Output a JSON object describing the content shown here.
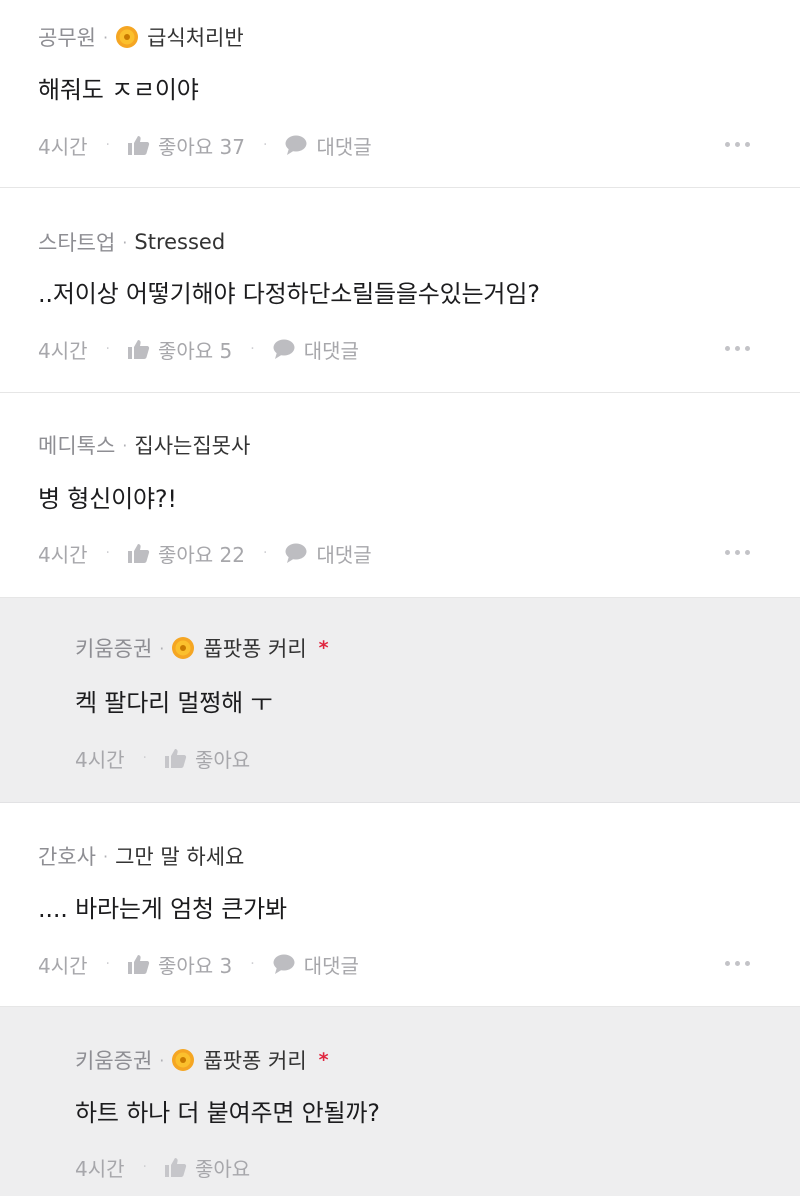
{
  "comments": [
    {
      "company": "공무원",
      "nickname": "급식처리반",
      "has_badge": true,
      "has_star": false,
      "reply": false,
      "text": "해줘도 ㅈㄹ이야",
      "time": "4시간",
      "like_label": "좋아요 37",
      "reply_label": "대댓글"
    },
    {
      "company": "스타트업",
      "nickname": "Stressed",
      "has_badge": false,
      "has_star": false,
      "reply": false,
      "text": "..저이상 어떻기해야 다정하단소릴들을수있는거임?",
      "time": "4시간",
      "like_label": "좋아요 5",
      "reply_label": "대댓글"
    },
    {
      "company": "메디톡스",
      "nickname": "집사는집못사",
      "has_badge": false,
      "has_star": false,
      "reply": false,
      "text": "병 형신이야?!",
      "time": "4시간",
      "like_label": "좋아요 22",
      "reply_label": "대댓글"
    },
    {
      "company": "키움증권",
      "nickname": "풉팟퐁 커리",
      "has_badge": true,
      "has_star": true,
      "star": "*",
      "reply": true,
      "text": "켁 팔다리 멀쩡해 ㅜ",
      "time": "4시간",
      "like_label": "좋아요"
    },
    {
      "company": "간호사",
      "nickname": "그만 말 하세요",
      "has_badge": false,
      "has_star": false,
      "reply": false,
      "text": ".... 바라는게 엄청 큰가봐",
      "time": "4시간",
      "like_label": "좋아요 3",
      "reply_label": "대댓글"
    },
    {
      "company": "키움증권",
      "nickname": "풉팟퐁 커리",
      "has_badge": true,
      "has_star": true,
      "star": "*",
      "reply": true,
      "text": "하트 하나 더 붙여주면 안될까?",
      "time": "4시간",
      "like_label": "좋아요"
    }
  ],
  "separator": "·",
  "colors": {
    "reply_bg": "#eeeeef",
    "star": "#e0263f",
    "badge": "#f5a623",
    "muted": "#a7a7ab"
  },
  "icons": {
    "like": "thumbs-up-icon",
    "reply": "speech-bubble-icon",
    "more": "more-horizontal-icon",
    "badge": "flower-badge-icon"
  }
}
